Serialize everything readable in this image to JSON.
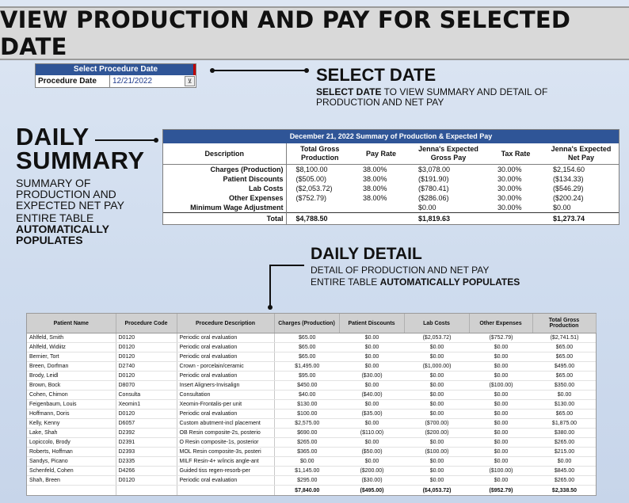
{
  "banner": {
    "title": "VIEW PRODUCTION AND PAY FOR SELECTED DATE"
  },
  "select_widget": {
    "header": "Select Procedure Date",
    "label": "Procedure Date",
    "value": "12/21/2022",
    "filter_glyph": "⊻"
  },
  "callouts": {
    "select_date": {
      "heading": "SELECT DATE",
      "text_bold": "SELECT DATE",
      "text_rest": " TO VIEW SUMMARY AND DETAIL OF PRODUCTION AND NET PAY"
    },
    "daily_summary": {
      "heading_line1": "DAILY",
      "heading_line2": "SUMMARY",
      "text": "SUMMARY OF PRODUCTION AND EXPECTED NET PAY",
      "text2": "ENTIRE TABLE",
      "text2_bold": "AUTOMATICALLY POPULATES"
    },
    "daily_detail": {
      "heading": "DAILY DETAIL",
      "line1": "DETAIL OF PRODUCTION AND NET PAY",
      "line2": "ENTIRE TABLE ",
      "line2_bold": "AUTOMATICALLY POPULATES"
    }
  },
  "summary": {
    "title": "December 21, 2022 Summary of Production & Expected Pay",
    "headers": [
      "Description",
      "Total Gross Production",
      "Pay Rate",
      "Jenna's Expected Gross Pay",
      "Tax Rate",
      "Jenna's Expected Net Pay"
    ],
    "rows": [
      [
        "Charges (Production)",
        "$8,100.00",
        "38.00%",
        "$3,078.00",
        "30.00%",
        "$2,154.60"
      ],
      [
        "Patient Discounts",
        "($505.00)",
        "38.00%",
        "($191.90)",
        "30.00%",
        "($134.33)"
      ],
      [
        "Lab Costs",
        "($2,053.72)",
        "38.00%",
        "($780.41)",
        "30.00%",
        "($546.29)"
      ],
      [
        "Other Expenses",
        "($752.79)",
        "38.00%",
        "($286.06)",
        "30.00%",
        "($200.24)"
      ],
      [
        "Minimum Wage Adjustment",
        "",
        "",
        "$0.00",
        "30.00%",
        "$0.00"
      ]
    ],
    "total": [
      "Total",
      "$4,788.50",
      "",
      "$1,819.63",
      "",
      "$1,273.74"
    ]
  },
  "detail": {
    "headers": [
      "Patient Name",
      "Procedure Code",
      "Procedure Description",
      "Charges (Production)",
      "Patient Discounts",
      "Lab Costs",
      "Other Expenses",
      "Total Gross Production"
    ],
    "rows": [
      [
        "Ahlfeld, Smith",
        "D0120",
        "Periodic oral evaluation",
        "$65.00",
        "$0.00",
        "($2,053.72)",
        "($752.79)",
        "($2,741.51)"
      ],
      [
        "Ahlfeld, Widiitz",
        "D0120",
        "Periodic oral evaluation",
        "$65.00",
        "$0.00",
        "$0.00",
        "$0.00",
        "$65.00"
      ],
      [
        "Bernier, Tort",
        "D0120",
        "Periodic oral evaluation",
        "$65.00",
        "$0.00",
        "$0.00",
        "$0.00",
        "$65.00"
      ],
      [
        "Breen, Dorfman",
        "D2740",
        "Crown - porcelain/ceramic",
        "$1,495.00",
        "$0.00",
        "($1,000.00)",
        "$0.00",
        "$495.00"
      ],
      [
        "Brody, Leidl",
        "D0120",
        "Periodic oral evaluation",
        "$95.00",
        "($30.00)",
        "$0.00",
        "$0.00",
        "$65.00"
      ],
      [
        "Brown, Bock",
        "D8070",
        "Insert Aligners-Invisalign",
        "$450.00",
        "$0.00",
        "$0.00",
        "($100.00)",
        "$350.00"
      ],
      [
        "Cohen, Chimon",
        "Consulta",
        "Consultation",
        "$40.00",
        "($40.00)",
        "$0.00",
        "$0.00",
        "$0.00"
      ],
      [
        "Feigenbaum, Louis",
        "Xeomin1",
        "Xeomin-Frontalis-per unit",
        "$130.00",
        "$0.00",
        "$0.00",
        "$0.00",
        "$130.00"
      ],
      [
        "Hoffmann, Doris",
        "D0120",
        "Periodic oral evaluation",
        "$100.00",
        "($35.00)",
        "$0.00",
        "$0.00",
        "$65.00"
      ],
      [
        "Kelly, Kenny",
        "D6057",
        "Custom abutment-incl placement",
        "$2,575.00",
        "$0.00",
        "($700.00)",
        "$0.00",
        "$1,875.00"
      ],
      [
        "Lake, Shah",
        "D2392",
        "OB Resin composite-2s, posterio",
        "$690.00",
        "($110.00)",
        "($200.00)",
        "$0.00",
        "$380.00"
      ],
      [
        "Lopiccolo, Brody",
        "D2391",
        "O Resin composite-1s, posterior",
        "$265.00",
        "$0.00",
        "$0.00",
        "$0.00",
        "$265.00"
      ],
      [
        "Roberts, Hoffman",
        "D2393",
        "MOL Resin composite-3s, posteri",
        "$365.00",
        "($50.00)",
        "($100.00)",
        "$0.00",
        "$215.00"
      ],
      [
        "Sandys, Picano",
        "D2335",
        "MILF Resin-4+ w/incis angle-ant",
        "$0.00",
        "$0.00",
        "$0.00",
        "$0.00",
        "$0.00"
      ],
      [
        "Schenfeld, Cohen",
        "D4266",
        "Guided tiss regen-resorb-per",
        "$1,145.00",
        "($200.00)",
        "$0.00",
        "($100.00)",
        "$845.00"
      ],
      [
        "Shah, Breen",
        "D0120",
        "Periodic oral evaluation",
        "$295.00",
        "($30.00)",
        "$0.00",
        "$0.00",
        "$265.00"
      ]
    ],
    "totals": [
      "",
      "",
      "",
      "$7,840.00",
      "($495.00)",
      "($4,053.72)",
      "($952.79)",
      "$2,338.50"
    ]
  }
}
